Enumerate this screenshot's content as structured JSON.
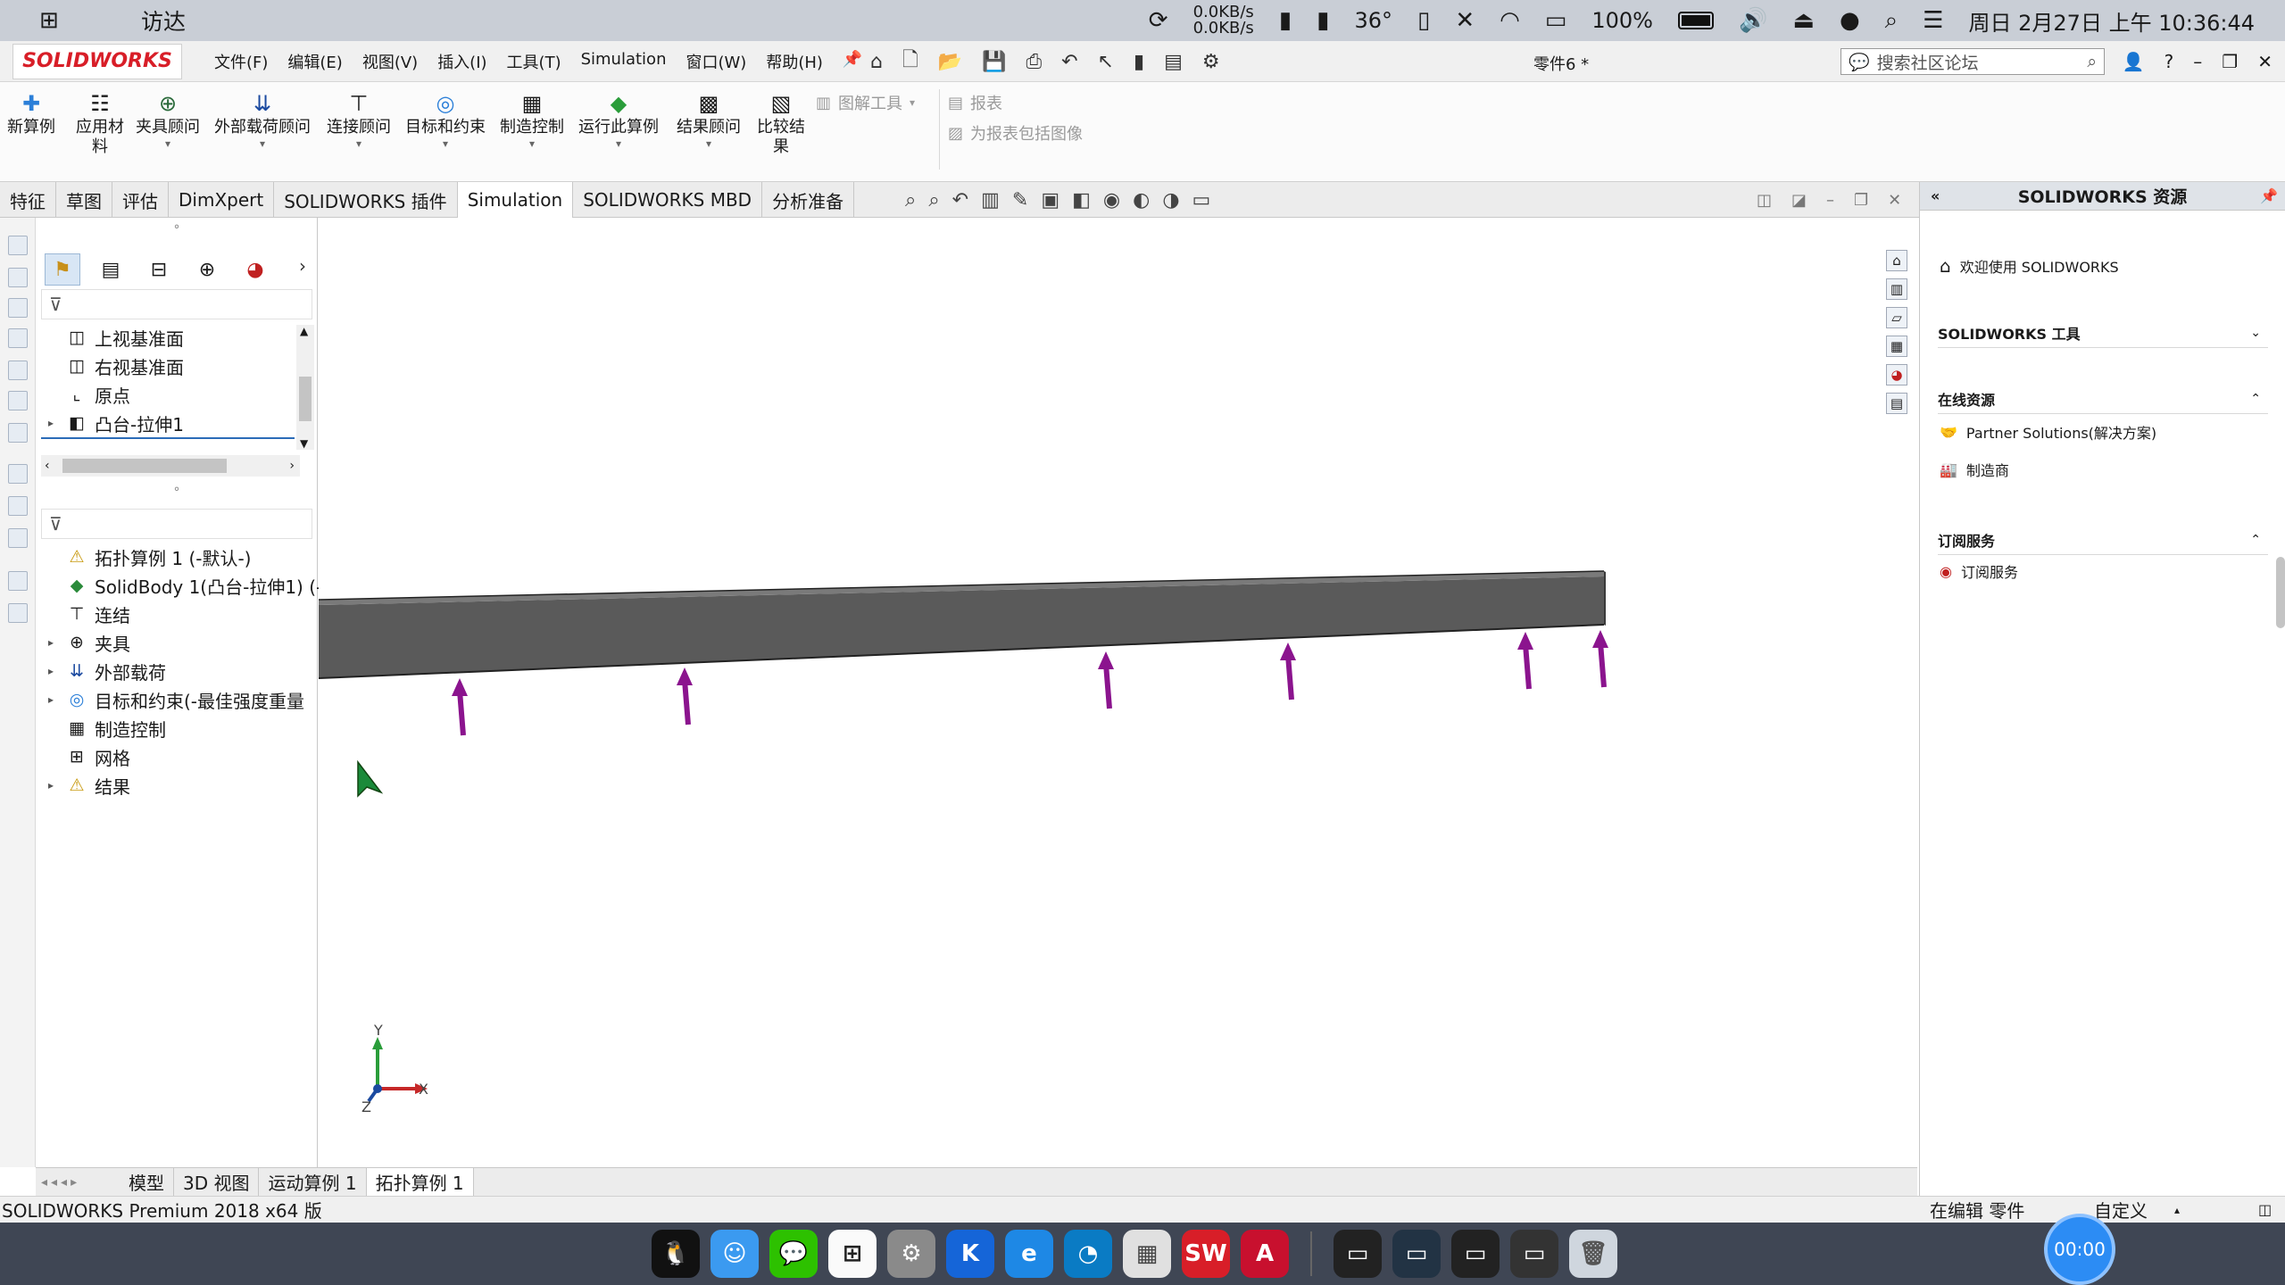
{
  "macbar": {
    "app_name": "访达",
    "net_up": "0.0KB/s",
    "net_down": "0.0KB/s",
    "temperature": "36°",
    "battery": "100%",
    "datetime": "周日 2月27日 上午 10:36:44"
  },
  "titlebar": {
    "logo": "SOLIDWORKS",
    "menus": [
      "文件(F)",
      "编辑(E)",
      "视图(V)",
      "插入(I)",
      "工具(T)",
      "Simulation",
      "窗口(W)",
      "帮助(H)"
    ],
    "document": "零件6 *",
    "search_placeholder": "搜索社区论坛"
  },
  "ribbon": {
    "buttons": [
      {
        "label": "新算例",
        "icon": "study-icon"
      },
      {
        "label": "应用材料",
        "icon": "material-icon"
      },
      {
        "label": "夹具顾问",
        "icon": "fixture-icon"
      },
      {
        "label": "外部载荷顾问",
        "icon": "load-icon"
      },
      {
        "label": "连接顾问",
        "icon": "connection-icon"
      },
      {
        "label": "目标和约束",
        "icon": "goal-icon"
      },
      {
        "label": "制造控制",
        "icon": "manufacturing-icon"
      },
      {
        "label": "运行此算例",
        "icon": "run-icon"
      },
      {
        "label": "结果顾问",
        "icon": "result-icon"
      },
      {
        "label": "比较结果",
        "icon": "compare-icon"
      }
    ],
    "disabled": {
      "plot_tools": "图解工具",
      "report": "报表",
      "include_image": "为报表包括图像"
    }
  },
  "tabs": [
    "特征",
    "草图",
    "评估",
    "DimXpert",
    "SOLIDWORKS 插件",
    "Simulation",
    "SOLIDWORKS MBD",
    "分析准备"
  ],
  "active_tab": "Simulation",
  "feature_tree": [
    {
      "label": "上视基准面",
      "icon": "plane-icon",
      "expandable": false
    },
    {
      "label": "右视基准面",
      "icon": "plane-icon",
      "expandable": false
    },
    {
      "label": "原点",
      "icon": "origin-icon",
      "expandable": false
    },
    {
      "label": "凸台-拉伸1",
      "icon": "extrude-icon",
      "expandable": true
    }
  ],
  "study_tree": [
    {
      "label": "拓扑算例 1 (-默认-)",
      "icon": "topology-study-icon",
      "expandable": false
    },
    {
      "label": "SolidBody 1(凸台-拉伸1) (-",
      "icon": "solid-body-icon",
      "expandable": false
    },
    {
      "label": "连结",
      "icon": "connection-icon",
      "expandable": false
    },
    {
      "label": "夹具",
      "icon": "fixture-icon",
      "expandable": true
    },
    {
      "label": "外部载荷",
      "icon": "load-icon",
      "expandable": true
    },
    {
      "label": "目标和约束(-最佳强度重量",
      "icon": "goal-icon",
      "expandable": true
    },
    {
      "label": "制造控制",
      "icon": "manufacturing-icon",
      "expandable": false
    },
    {
      "label": "网格",
      "icon": "mesh-icon",
      "expandable": false
    },
    {
      "label": "结果",
      "icon": "results-warning-icon",
      "expandable": true
    }
  ],
  "axes": {
    "x": "X",
    "y": "Y",
    "z": "Z"
  },
  "model_tabs": [
    "模型",
    "3D 视图",
    "运动算例 1",
    "拓扑算例 1"
  ],
  "active_model_tab": "拓扑算例 1",
  "status": {
    "product": "SOLIDWORKS Premium 2018 x64 版",
    "mode": "在编辑 零件",
    "units": "自定义"
  },
  "taskpane": {
    "title": "SOLIDWORKS 资源",
    "welcome": "欢迎使用 SOLIDWORKS",
    "sections": [
      {
        "title": "SOLIDWORKS 工具",
        "collapsed": true,
        "items": []
      },
      {
        "title": "在线资源",
        "collapsed": false,
        "items": [
          "Partner Solutions(解决方案)",
          "制造商"
        ]
      },
      {
        "title": "订阅服务",
        "collapsed": false,
        "items": [
          "订阅服务"
        ]
      }
    ]
  },
  "recorder": {
    "time": "00:00"
  },
  "colors": {
    "beam": "#5a5a5a",
    "beam_top": "#7a7a7a",
    "load_arrow": "#8b148e",
    "accent": "#2c8cf4"
  }
}
